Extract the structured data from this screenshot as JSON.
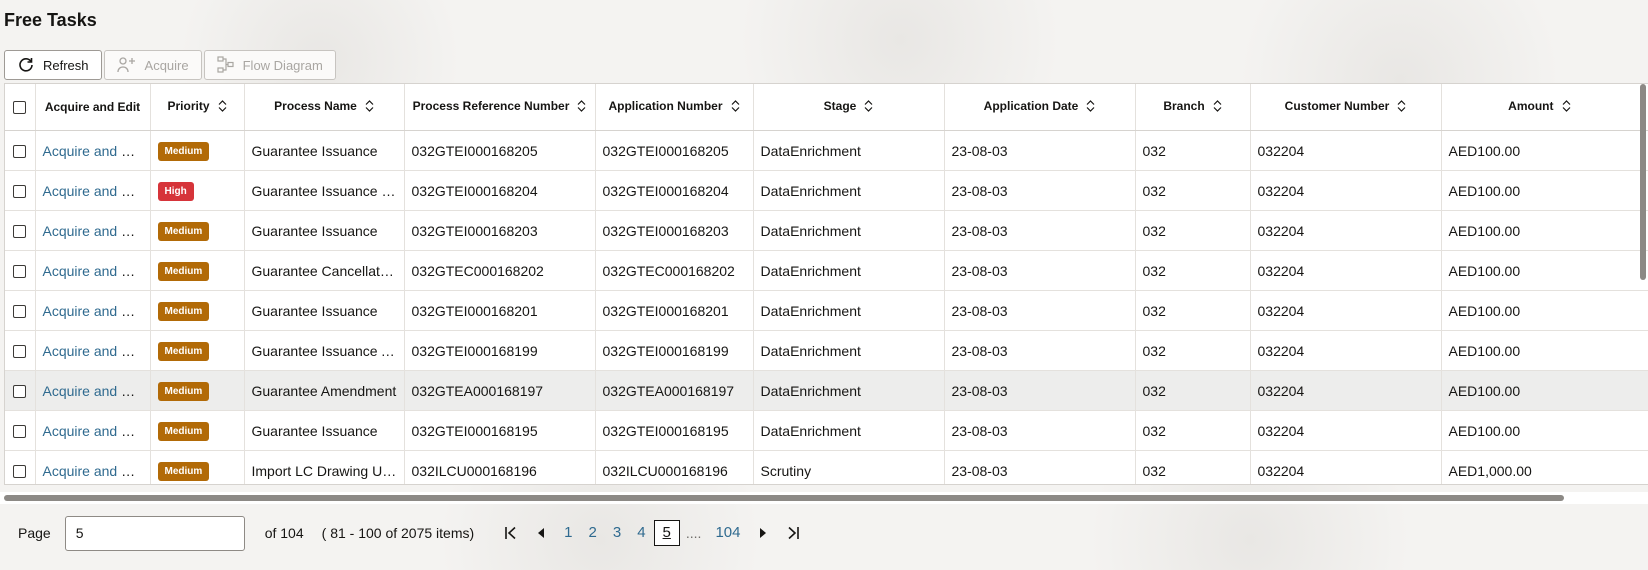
{
  "page": {
    "title": "Free Tasks"
  },
  "toolbar": {
    "refresh_label": "Refresh",
    "acquire_label": "Acquire",
    "flow_label": "Flow Diagram"
  },
  "columns": [
    "Acquire and Edit",
    "Priority",
    "Process Name",
    "Process Reference Number",
    "Application Number",
    "Stage",
    "Application Date",
    "Branch",
    "Customer Number",
    "Amount"
  ],
  "priority_colors": {
    "Medium": "#b26a07",
    "High": "#d6343a"
  },
  "rows": [
    {
      "action": "Acquire and Edit",
      "priority": "Medium",
      "process": "Guarantee Issuance",
      "ref": "032GTEI000168205",
      "app": "032GTEI000168205",
      "stage": "DataEnrichment",
      "date": "23-08-03",
      "branch": "032",
      "customer": "032204",
      "amount": "AED100.00"
    },
    {
      "action": "Acquire and Edit",
      "priority": "High",
      "process": "Guarantee Issuance In...",
      "ref": "032GTEI000168204",
      "app": "032GTEI000168204",
      "stage": "DataEnrichment",
      "date": "23-08-03",
      "branch": "032",
      "customer": "032204",
      "amount": "AED100.00"
    },
    {
      "action": "Acquire and Edit",
      "priority": "Medium",
      "process": "Guarantee Issuance",
      "ref": "032GTEI000168203",
      "app": "032GTEI000168203",
      "stage": "DataEnrichment",
      "date": "23-08-03",
      "branch": "032",
      "customer": "032204",
      "amount": "AED100.00"
    },
    {
      "action": "Acquire and Edit",
      "priority": "Medium",
      "process": "Guarantee Cancellation",
      "ref": "032GTEC000168202",
      "app": "032GTEC000168202",
      "stage": "DataEnrichment",
      "date": "23-08-03",
      "branch": "032",
      "customer": "032204",
      "amount": "AED100.00"
    },
    {
      "action": "Acquire and Edit",
      "priority": "Medium",
      "process": "Guarantee Issuance",
      "ref": "032GTEI000168201",
      "app": "032GTEI000168201",
      "stage": "DataEnrichment",
      "date": "23-08-03",
      "branch": "032",
      "customer": "032204",
      "amount": "AED100.00"
    },
    {
      "action": "Acquire and Edit",
      "priority": "Medium",
      "process": "Guarantee Issuance A...",
      "ref": "032GTEI000168199",
      "app": "032GTEI000168199",
      "stage": "DataEnrichment",
      "date": "23-08-03",
      "branch": "032",
      "customer": "032204",
      "amount": "AED100.00"
    },
    {
      "action": "Acquire and Edit",
      "priority": "Medium",
      "process": "Guarantee Amendment",
      "ref": "032GTEA000168197",
      "app": "032GTEA000168197",
      "stage": "DataEnrichment",
      "date": "23-08-03",
      "branch": "032",
      "customer": "032204",
      "amount": "AED100.00",
      "selected": true
    },
    {
      "action": "Acquire and Edit",
      "priority": "Medium",
      "process": "Guarantee Issuance",
      "ref": "032GTEI000168195",
      "app": "032GTEI000168195",
      "stage": "DataEnrichment",
      "date": "23-08-03",
      "branch": "032",
      "customer": "032204",
      "amount": "AED100.00"
    },
    {
      "action": "Acquire and Edit",
      "priority": "Medium",
      "process": "Import LC Drawing Up...",
      "ref": "032ILCU000168196",
      "app": "032ILCU000168196",
      "stage": "Scrutiny",
      "date": "23-08-03",
      "branch": "032",
      "customer": "032204",
      "amount": "AED1,000.00"
    }
  ],
  "pagination": {
    "page_label": "Page",
    "current_value": "5",
    "of_text": "of 104",
    "range_text": "( 81 - 100 of 2075 items)",
    "pages": [
      "1",
      "2",
      "3",
      "4",
      "5"
    ],
    "current_page": "5",
    "dots": "....",
    "last_page": "104"
  }
}
